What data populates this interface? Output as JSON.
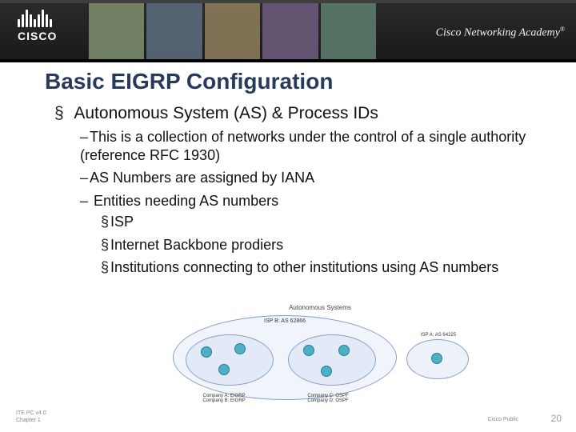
{
  "banner": {
    "logo_word": "CISCO",
    "academy": "Cisco Networking Academy"
  },
  "slide": {
    "title": "Basic EIGRP Configuration",
    "bullet1": "Autonomous System (AS) & Process IDs",
    "sub1": "This is a collection of networks under the control of a single authority (reference RFC 1930)",
    "sub2": "AS Numbers are assigned by IANA",
    "sub3": "Entities needing AS numbers",
    "sub3a": "ISP",
    "sub3b": "Internet Backbone prodiers",
    "sub3c": "Institutions connecting to other institutions using AS numbers"
  },
  "diagram": {
    "title": "Autonomous Systems",
    "big_label": "ISP B: AS 62866",
    "compA_name": "Company A: EIGRP",
    "compA_sub": "Company B: EIGRP",
    "compC_name": "Company C: OSPF",
    "compC_sub": "Company D: OSPF",
    "isp_label": "ISP A: AS 64225"
  },
  "footer": {
    "left_line1": "ITE PC v4.0",
    "left_line2": "Chapter 1",
    "center": "Cisco Public",
    "page": "20"
  }
}
